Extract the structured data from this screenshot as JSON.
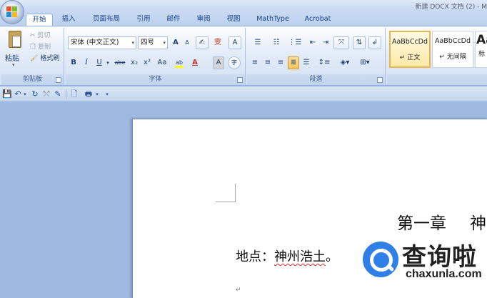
{
  "window": {
    "title": "新建 DOCX 文档 (2) - M"
  },
  "tabs": [
    "开始",
    "插入",
    "页面布局",
    "引用",
    "邮件",
    "审阅",
    "视图",
    "MathType",
    "Acrobat"
  ],
  "clipboard": {
    "paste_label": "粘贴",
    "cut_label": "剪切",
    "copy_label": "复制",
    "format_painter_label": "格式刷",
    "group_label": "剪贴板"
  },
  "font": {
    "font_name": "宋体 (中文正文)",
    "font_size": "四号",
    "grow_label": "A",
    "shrink_label": "A",
    "clear_format_label": "✍",
    "phonetic_label": "雯",
    "border_label": "A",
    "bold_label": "B",
    "italic_label": "I",
    "underline_label": "U",
    "strike_label": "abe",
    "subscript_label": "x₂",
    "superscript_label": "x²",
    "case_label": "Aa",
    "highlight_label": "ab",
    "font_color_label": "A",
    "shading_label": "A",
    "enclose_label": "字",
    "group_label": "字体",
    "highlight_color": "#ffff00",
    "font_color": "#e02020"
  },
  "paragraph": {
    "group_label": "段落"
  },
  "styles": {
    "items": [
      {
        "preview": "AaBbCcDd",
        "name": "↵ 正文"
      },
      {
        "preview": "AaBbCcDd",
        "name": "↵ 无间隔"
      },
      {
        "preview": "Aa",
        "name": "标"
      }
    ]
  },
  "document": {
    "chapter_title": "第一章",
    "chapter_next": "神",
    "place_label": "地点：",
    "place_value": "神州浩土",
    "place_end": "。",
    "paragraph_mark": "↵"
  },
  "watermark": {
    "text_cn": "查询啦",
    "url": "chaxunla.com",
    "color": "#2f7fe6"
  },
  "colors": {
    "accent": "#15428b",
    "ribbon_border": "#8db2e3",
    "doc_background": "#9eb9e0"
  }
}
